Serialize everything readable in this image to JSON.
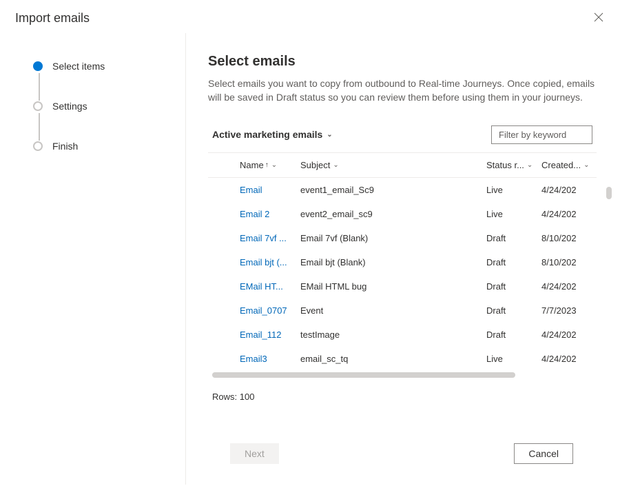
{
  "dialog": {
    "title": "Import emails"
  },
  "stepper": {
    "items": [
      {
        "label": "Select items",
        "active": true
      },
      {
        "label": "Settings",
        "active": false
      },
      {
        "label": "Finish",
        "active": false
      }
    ]
  },
  "main": {
    "title": "Select emails",
    "description": "Select emails you want to copy from outbound to Real-time Journeys. Once copied, emails will be saved in Draft status so you can review them before using them in your journeys.",
    "view_name": "Active marketing emails",
    "filter_placeholder": "Filter by keyword"
  },
  "grid": {
    "columns": {
      "name": "Name",
      "sort_indicator": "↑",
      "subject": "Subject",
      "status": "Status r...",
      "created": "Created..."
    },
    "rows": [
      {
        "name": "Email",
        "subject": "event1_email_Sc9",
        "status": "Live",
        "created": "4/24/202"
      },
      {
        "name": "Email 2",
        "subject": "event2_email_sc9",
        "status": "Live",
        "created": "4/24/202"
      },
      {
        "name": "Email 7vf ...",
        "subject": "Email 7vf (Blank)",
        "status": "Draft",
        "created": "8/10/202"
      },
      {
        "name": "Email bjt (...",
        "subject": "Email bjt (Blank)",
        "status": "Draft",
        "created": "8/10/202"
      },
      {
        "name": "EMail HT...",
        "subject": "EMail HTML bug",
        "status": "Draft",
        "created": "4/24/202"
      },
      {
        "name": "Email_0707",
        "subject": "Event",
        "status": "Draft",
        "created": "7/7/2023"
      },
      {
        "name": "Email_112",
        "subject": "testImage",
        "status": "Draft",
        "created": "4/24/202"
      },
      {
        "name": "Email3",
        "subject": "email_sc_tq",
        "status": "Live",
        "created": "4/24/202"
      }
    ],
    "footer": "Rows: 100"
  },
  "footer": {
    "next": "Next",
    "cancel": "Cancel"
  }
}
